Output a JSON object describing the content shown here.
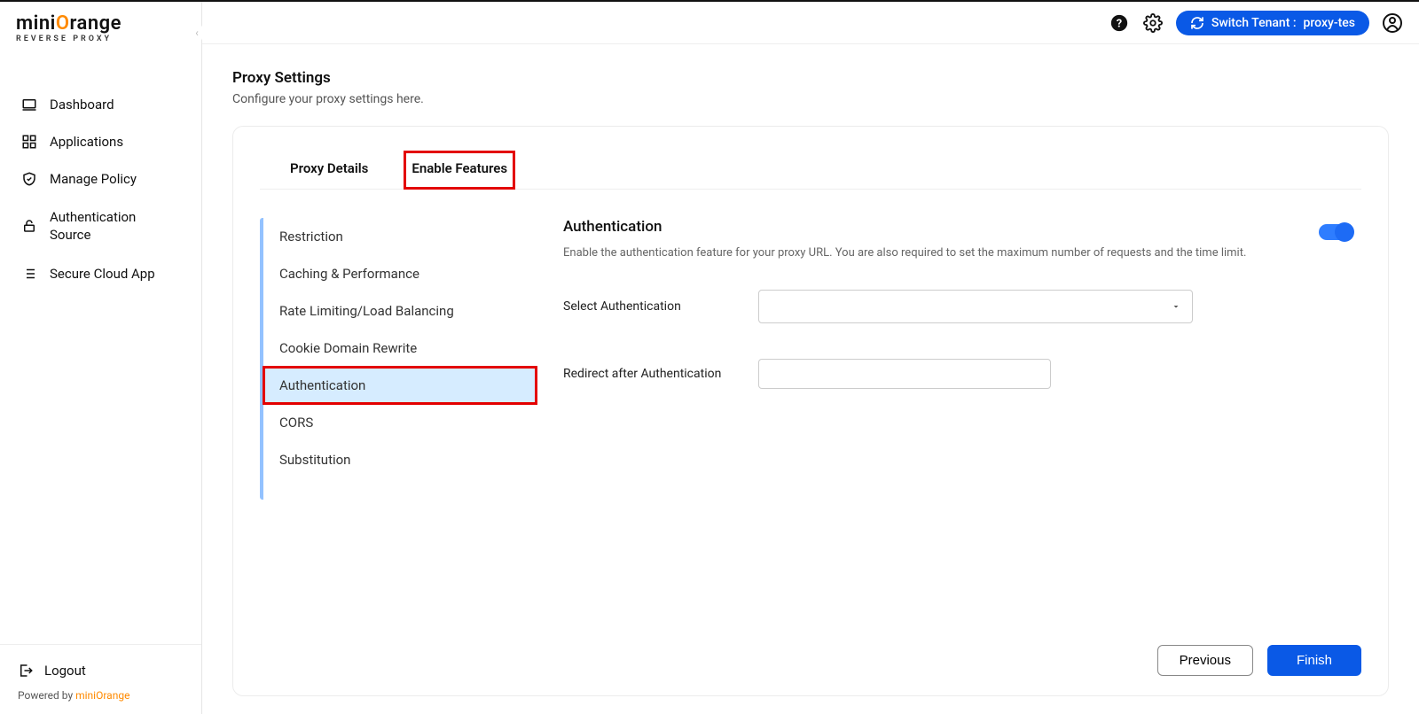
{
  "brand": {
    "name_pre": "mini",
    "name_accent": "O",
    "name_post": "range",
    "tagline": "REVERSE PROXY"
  },
  "sidebar": {
    "items": [
      {
        "label": "Dashboard",
        "icon": "laptop-icon"
      },
      {
        "label": "Applications",
        "icon": "apps-icon"
      },
      {
        "label": "Manage Policy",
        "icon": "shield-check-icon"
      },
      {
        "label": "Authentication Source",
        "icon": "lock-icon"
      },
      {
        "label": "Secure Cloud App",
        "icon": "list-icon"
      }
    ],
    "logout": "Logout",
    "powered_prefix": "Powered by ",
    "powered_brand": "miniOrange"
  },
  "topbar": {
    "tenant_label": "Switch Tenant :",
    "tenant_value": "proxy-tes"
  },
  "page": {
    "title": "Proxy Settings",
    "description": "Configure your proxy settings here."
  },
  "tabs": {
    "proxy_details": "Proxy Details",
    "enable_features": "Enable Features"
  },
  "feature_nav": [
    "Restriction",
    "Caching & Performance",
    "Rate Limiting/Load Balancing",
    "Cookie Domain Rewrite",
    "Authentication",
    "CORS",
    "Substitution"
  ],
  "panel": {
    "title": "Authentication",
    "description": "Enable the authentication feature for your proxy URL. You are also required to set the maximum number of requests and the time limit.",
    "toggle_on": true,
    "select_auth_label": "Select Authentication",
    "select_auth_value": "",
    "redirect_label": "Redirect after Authentication",
    "redirect_value": ""
  },
  "actions": {
    "previous": "Previous",
    "finish": "Finish"
  }
}
